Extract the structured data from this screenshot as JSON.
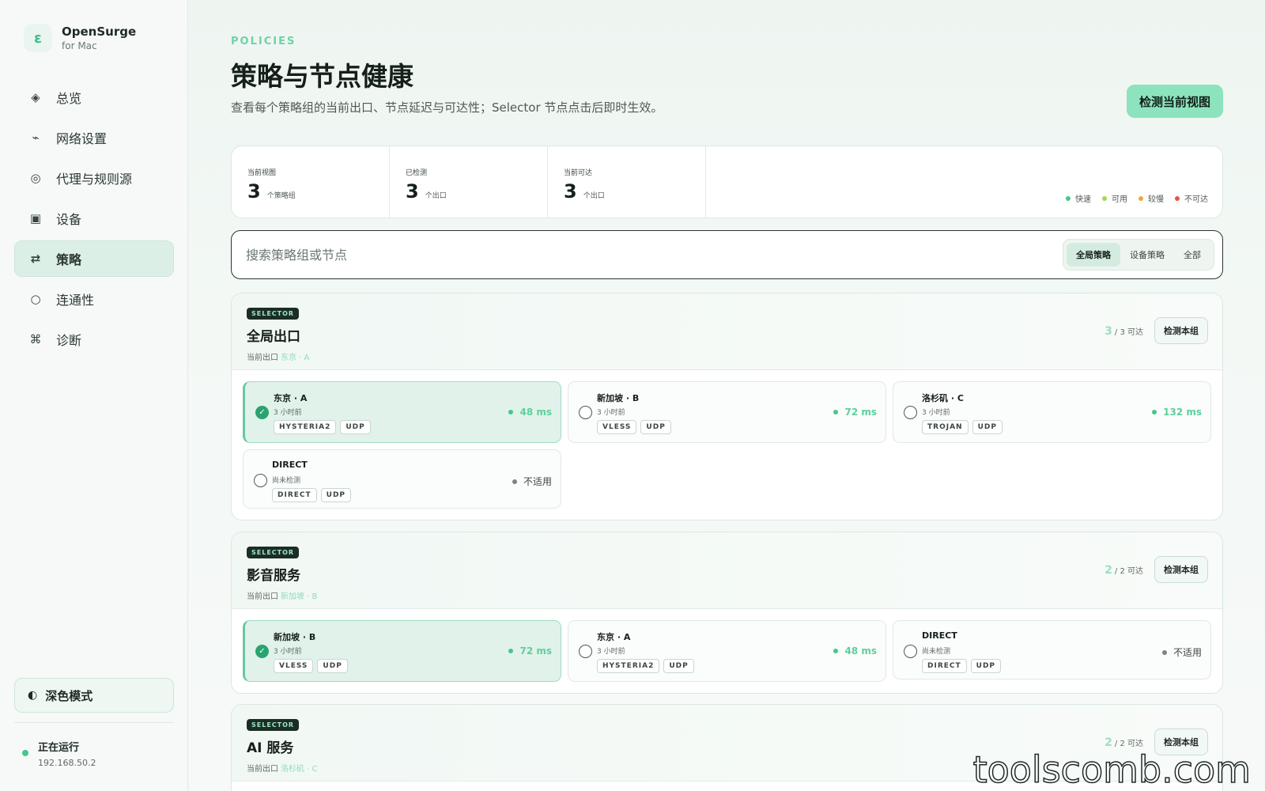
{
  "app": {
    "name": "OpenSurge",
    "subtitle": "for Mac",
    "logo_glyph": "ɛ"
  },
  "sidebar": {
    "items": [
      {
        "label": "总览",
        "icon": "diamond-icon",
        "glyph": "◈",
        "active": false
      },
      {
        "label": "网络设置",
        "icon": "network-icon",
        "glyph": "⌁",
        "active": false
      },
      {
        "label": "代理与规则源",
        "icon": "target-icon",
        "glyph": "◎",
        "active": false
      },
      {
        "label": "设备",
        "icon": "device-icon",
        "glyph": "▣",
        "active": false
      },
      {
        "label": "策略",
        "icon": "swap-icon",
        "glyph": "⇄",
        "active": true
      },
      {
        "label": "连通性",
        "icon": "circle-icon",
        "glyph": "○",
        "active": false
      },
      {
        "label": "诊断",
        "icon": "command-icon",
        "glyph": "⌘",
        "active": false
      }
    ],
    "dark_mode": {
      "label": "深色模式",
      "glyph": "◐"
    },
    "status": {
      "title": "正在运行",
      "ip": "192.168.50.2"
    }
  },
  "header": {
    "eyebrow": "POLICIES",
    "title": "策略与节点健康",
    "description": "查看每个策略组的当前出口、节点延迟与可达性；Selector 节点点击后即时生效。",
    "detect_view_label": "检测当前视图"
  },
  "stats": [
    {
      "label": "当前视图",
      "value": "3",
      "unit": "个策略组"
    },
    {
      "label": "已检测",
      "value": "3",
      "unit": "个出口"
    },
    {
      "label": "当前可达",
      "value": "3",
      "unit": "个出口"
    }
  ],
  "legend": [
    {
      "label": "快速",
      "color": "#42c98b"
    },
    {
      "label": "可用",
      "color": "#a8d455"
    },
    {
      "label": "较慢",
      "color": "#f0a53c"
    },
    {
      "label": "不可达",
      "color": "#e8524a"
    }
  ],
  "search": {
    "placeholder": "搜索策略组或节点",
    "value": ""
  },
  "scope": {
    "options": [
      "全局策略",
      "设备策略",
      "全部"
    ],
    "selected": "全局策略"
  },
  "groups": [
    {
      "tag": "SELECTOR",
      "name": "全局出口",
      "exit_label": "当前出口",
      "exit_value": "东京 · A",
      "reach_num": "3",
      "reach_text": "/ 3 可达",
      "detect_label": "检测本组",
      "nodes": [
        {
          "name": "东京 · A",
          "time": "3 小时前",
          "chips": [
            "HYSTERIA2",
            "UDP"
          ],
          "latency": "48 ms",
          "selected": true,
          "na": false
        },
        {
          "name": "新加坡 · B",
          "time": "3 小时前",
          "chips": [
            "VLESS",
            "UDP"
          ],
          "latency": "72 ms",
          "selected": false,
          "na": false
        },
        {
          "name": "洛杉矶 · C",
          "time": "3 小时前",
          "chips": [
            "TROJAN",
            "UDP"
          ],
          "latency": "132 ms",
          "selected": false,
          "na": false
        },
        {
          "name": "DIRECT",
          "time": "尚未检测",
          "chips": [
            "DIRECT",
            "UDP"
          ],
          "latency": "不适用",
          "selected": false,
          "na": true
        }
      ]
    },
    {
      "tag": "SELECTOR",
      "name": "影音服务",
      "exit_label": "当前出口",
      "exit_value": "新加坡 · B",
      "reach_num": "2",
      "reach_text": "/ 2 可达",
      "detect_label": "检测本组",
      "nodes": [
        {
          "name": "新加坡 · B",
          "time": "3 小时前",
          "chips": [
            "VLESS",
            "UDP"
          ],
          "latency": "72 ms",
          "selected": true,
          "na": false
        },
        {
          "name": "东京 · A",
          "time": "3 小时前",
          "chips": [
            "HYSTERIA2",
            "UDP"
          ],
          "latency": "48 ms",
          "selected": false,
          "na": false
        },
        {
          "name": "DIRECT",
          "time": "尚未检测",
          "chips": [
            "DIRECT",
            "UDP"
          ],
          "latency": "不适用",
          "selected": false,
          "na": true
        }
      ]
    },
    {
      "tag": "SELECTOR",
      "name": "AI 服务",
      "exit_label": "当前出口",
      "exit_value": "洛杉矶 · C",
      "reach_num": "2",
      "reach_text": "/ 2 可达",
      "detect_label": "检测本组",
      "nodes": []
    }
  ],
  "watermark": "toolscomb.com"
}
